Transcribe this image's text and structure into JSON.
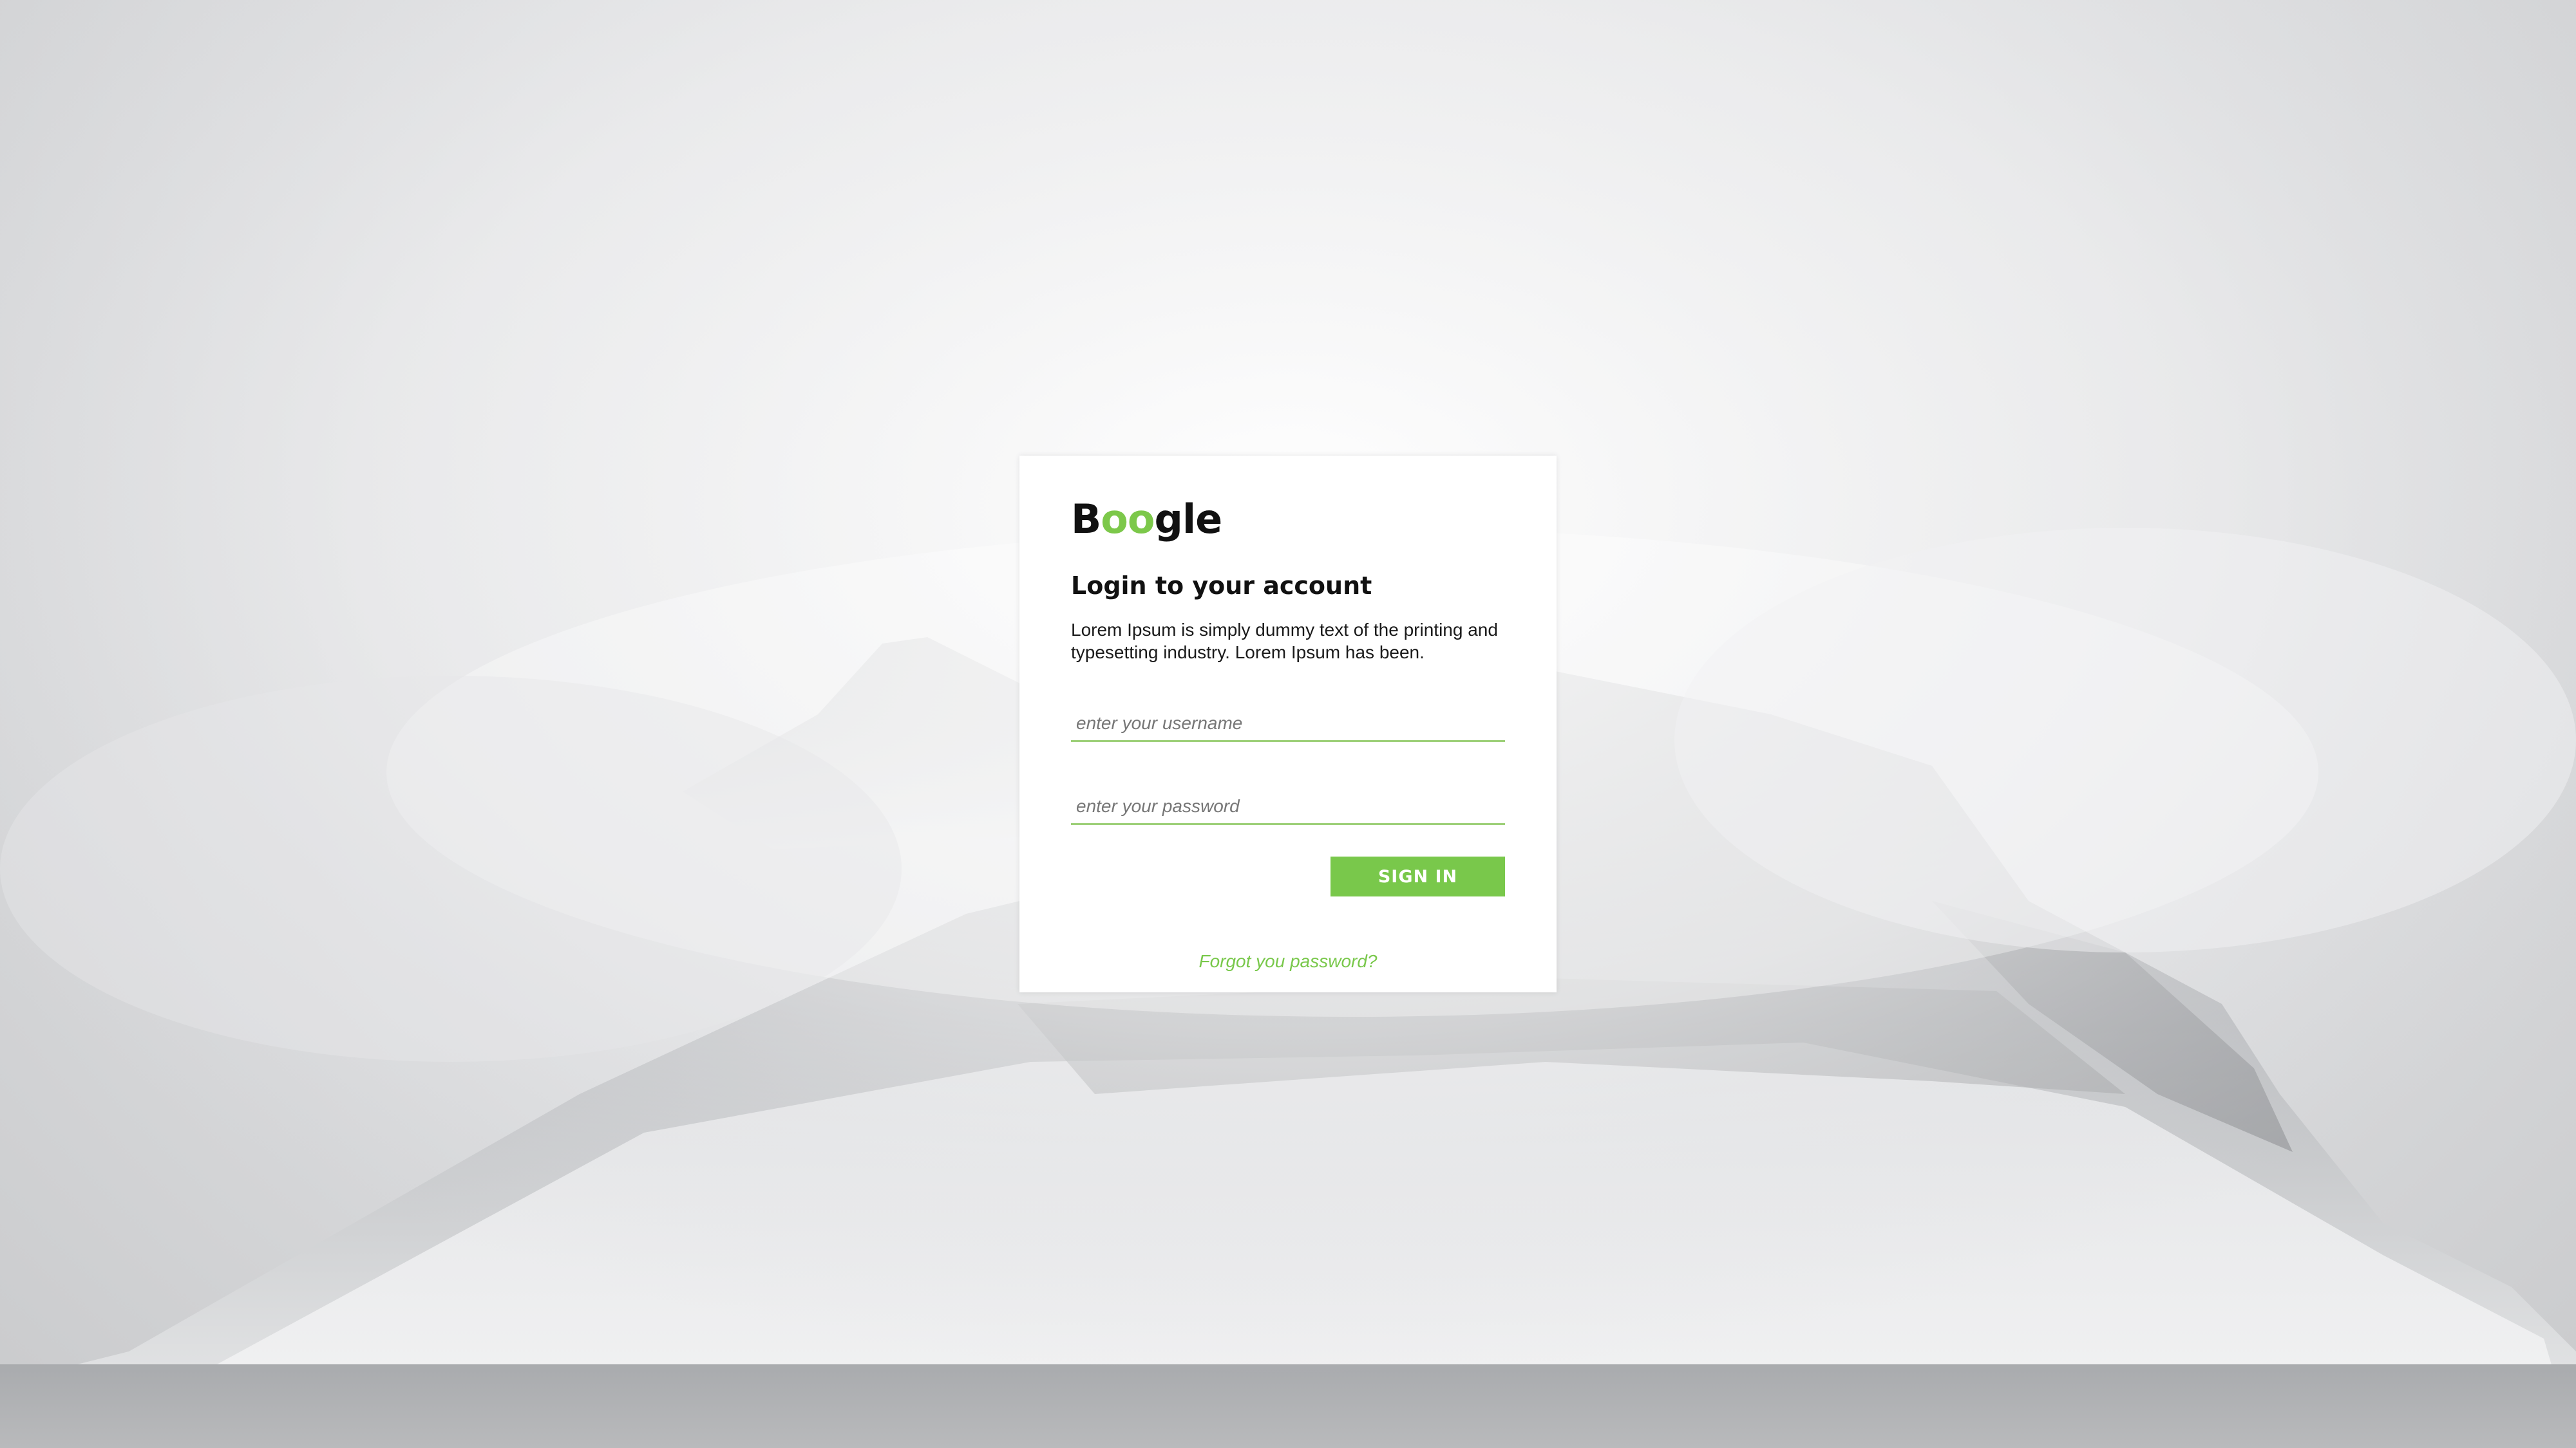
{
  "background": {
    "description_icon": "snowy-mountain-fog-image"
  },
  "colors": {
    "accent": "#79c84b",
    "card": "#ffffff",
    "text": "#111111"
  },
  "logo": {
    "part1": "B",
    "part2": "oo",
    "part3": "gle"
  },
  "login": {
    "title": "Login to your account",
    "description": "Lorem Ipsum is simply dummy text of the printing and typesetting industry. Lorem Ipsum has been.",
    "username_placeholder": "enter your username",
    "password_placeholder": "enter your password",
    "signin_label": "SIGN IN",
    "forgot_label": "Forgot you password?"
  }
}
